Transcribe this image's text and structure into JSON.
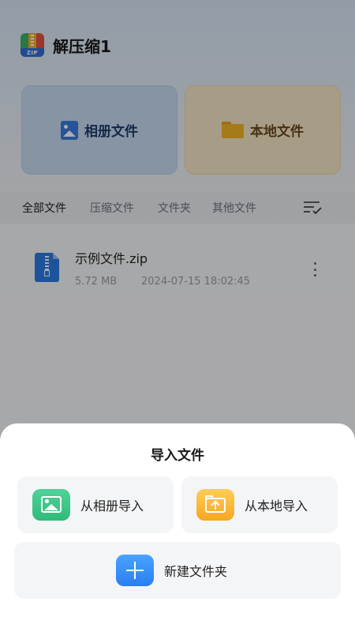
{
  "app": {
    "title": "解压缩1"
  },
  "quick_cards": {
    "album": {
      "label": "相册文件",
      "icon": "image-icon",
      "color": "#3a7be0"
    },
    "local": {
      "label": "本地文件",
      "icon": "folder-icon",
      "color": "#f3b425"
    }
  },
  "tabs": [
    {
      "label": "全部文件",
      "active": true
    },
    {
      "label": "压缩文件",
      "active": false
    },
    {
      "label": "文件夹",
      "active": false
    },
    {
      "label": "其他文件",
      "active": false
    }
  ],
  "files": [
    {
      "name": "示例文件.zip",
      "size": "5.72 MB",
      "date": "2024-07-15 18:02:45",
      "icon": "zip-file-icon"
    }
  ],
  "import_sheet": {
    "title": "导入文件",
    "options": {
      "album": {
        "label": "从相册导入",
        "icon": "image-icon",
        "color": "#2fbb79"
      },
      "local": {
        "label": "从本地导入",
        "icon": "folder-upload-icon",
        "color": "#f6a623"
      },
      "new_folder": {
        "label": "新建文件夹",
        "icon": "plus-icon",
        "color": "#2b7ef2"
      }
    }
  }
}
